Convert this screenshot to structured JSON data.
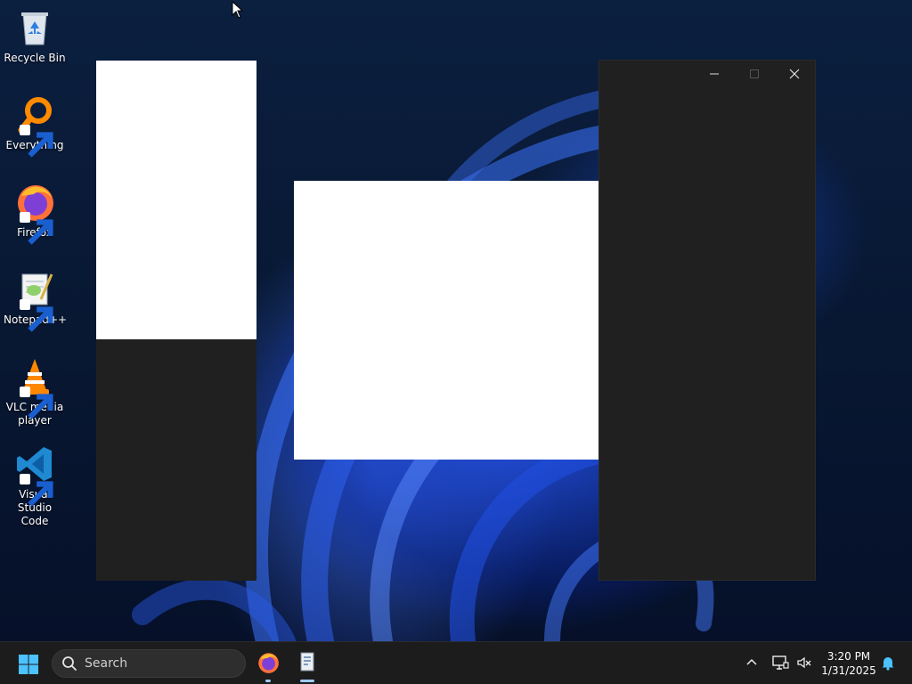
{
  "desktop": {
    "icons": [
      {
        "label": "Recycle Bin",
        "icon": "recycle-bin-icon"
      },
      {
        "label": "Everything",
        "icon": "everything-search-icon"
      },
      {
        "label": "Firefox",
        "icon": "firefox-icon"
      },
      {
        "label": "Notepad++",
        "icon": "notepad-plus-plus-icon"
      },
      {
        "label": "VLC media player",
        "icon": "vlc-icon"
      },
      {
        "label": "Visual Studio Code",
        "icon": "vscode-icon"
      }
    ]
  },
  "windows": {
    "right": {
      "minimize_icon": "minimize-icon",
      "maximize_icon": "maximize-icon",
      "close_icon": "close-icon"
    }
  },
  "taskbar": {
    "start_icon": "windows-start-icon",
    "search": {
      "placeholder": "Search",
      "icon": "search-icon"
    },
    "pinned": [
      "firefox-icon",
      "app-window-icon"
    ],
    "tray": {
      "chevron_icon": "chevron-up-icon",
      "network_icon": "network-icon",
      "volume_icon": "volume-muted-icon",
      "time": "3:20 PM",
      "date": "1/31/2025",
      "notification_icon": "bell-icon"
    }
  },
  "colors": {
    "taskbar": "#1c1c1c",
    "window_dark": "#202020",
    "accent": "#0078d4"
  }
}
